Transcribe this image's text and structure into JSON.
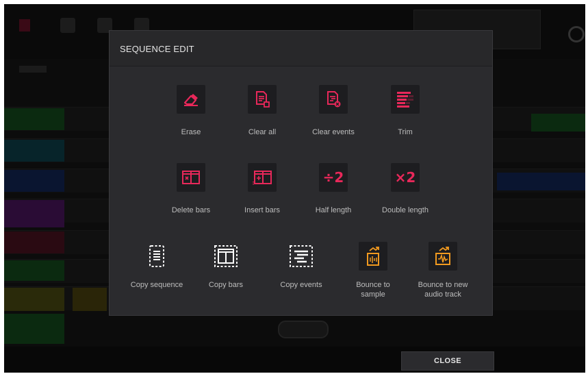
{
  "dialog": {
    "title": "SEQUENCE EDIT",
    "operations": [
      {
        "id": "erase",
        "label": "Erase",
        "icon": "eraser-icon"
      },
      {
        "id": "clear-all",
        "label": "Clear all",
        "icon": "clear-all-icon"
      },
      {
        "id": "clear-events",
        "label": "Clear events",
        "icon": "clear-events-icon"
      },
      {
        "id": "trim",
        "label": "Trim",
        "icon": "trim-icon"
      },
      {
        "id": "delete-bars",
        "label": "Delete bars",
        "icon": "delete-bars-icon"
      },
      {
        "id": "insert-bars",
        "label": "Insert bars",
        "icon": "insert-bars-icon"
      },
      {
        "id": "half-length",
        "label": "Half length",
        "icon": "divide-two-icon",
        "glyph": "÷2"
      },
      {
        "id": "double-length",
        "label": "Double length",
        "icon": "times-two-icon",
        "glyph": "×2"
      },
      {
        "id": "copy-sequence",
        "label": "Copy sequence",
        "icon": "copy-sequence-icon"
      },
      {
        "id": "copy-bars",
        "label": "Copy bars",
        "icon": "copy-bars-icon"
      },
      {
        "id": "copy-events",
        "label": "Copy events",
        "icon": "copy-events-icon"
      },
      {
        "id": "bounce-to-sample",
        "label": "Bounce to\nsample",
        "icon": "bounce-sample-icon"
      },
      {
        "id": "bounce-to-new-audio-track",
        "label": "Bounce to new\naudio track",
        "icon": "bounce-audio-track-icon"
      }
    ]
  },
  "close_label": "CLOSE",
  "colors": {
    "accent_pink": "#e8285a",
    "accent_orange": "#f29a1f",
    "dialog_bg": "#2b2b2e",
    "tile_bg": "#1d1d20",
    "text": "#bdbdbd"
  }
}
